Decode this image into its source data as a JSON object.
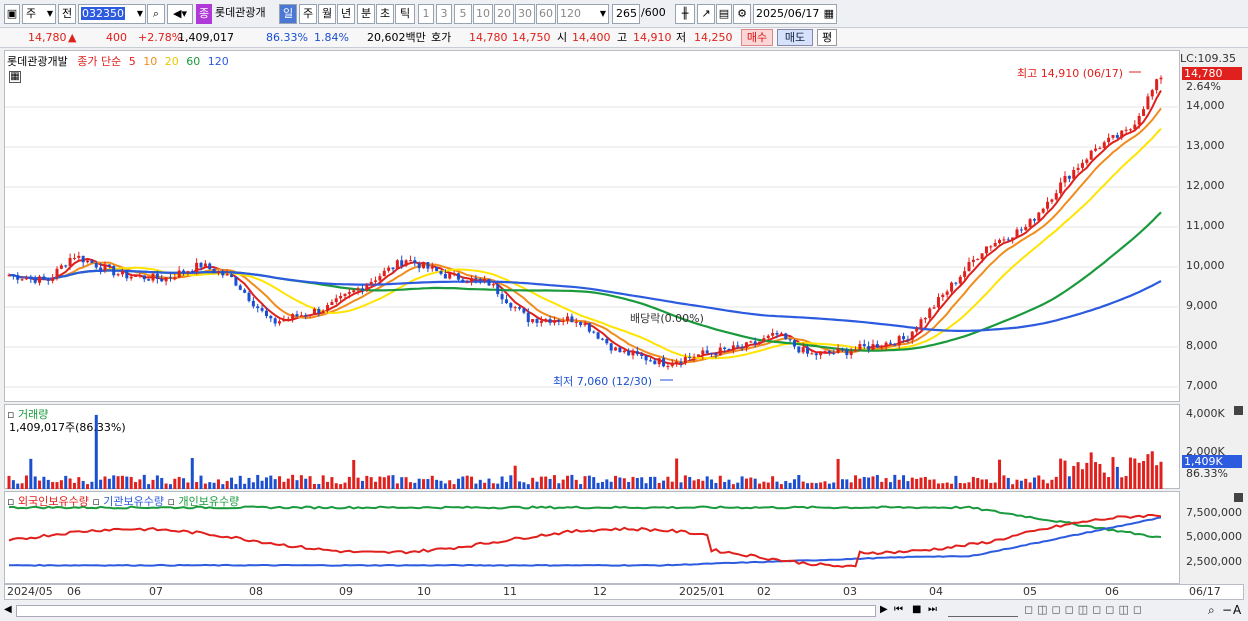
{
  "toolbar": {
    "market_select": "주",
    "period_select": "전",
    "code_value": "032350",
    "stock_badge": "종",
    "stock_name": "롯데관광개",
    "tf_day": "일",
    "tf_week": "주",
    "tf_month": "월",
    "tf_year": "년",
    "tf_min": "분",
    "tf_sec": "초",
    "tf_tick": "틱",
    "periods": [
      "1",
      "3",
      "5",
      "10",
      "20",
      "30",
      "60",
      "120"
    ],
    "count_value": "265",
    "count_total": "/600",
    "date_value": "2025/06/17"
  },
  "quote": {
    "price": "14,780",
    "up_arrow": "▲",
    "change": "400",
    "change_pct": "+2.78%",
    "volume": "1,409,017",
    "vol_ratio": "86.33%",
    "turnover": "1.84%",
    "amount": "20,602백만",
    "ask_label": "호가",
    "ask1": "14,780",
    "ask2": "14,750",
    "open_label": "시",
    "open": "14,400",
    "high_label": "고",
    "high": "14,910",
    "low_label": "저",
    "low": "14,250",
    "buy_button": "매수",
    "sell_button": "매도",
    "eval_button": "평"
  },
  "price_panel": {
    "title_name": "롯데관광개발",
    "legend_prefix": "종가 단순",
    "ma_labels": [
      "5",
      "10",
      "20",
      "60",
      "120"
    ],
    "ma_colors": [
      "#e0201c",
      "#f08c1c",
      "#ffe400",
      "#1a9a3c",
      "#2c5be0"
    ],
    "lc_label": "LC:109.35",
    "current_price_tag": "14,780",
    "current_pct": "2.64%",
    "high_annotation": "최고 14,910 (06/17)",
    "low_annotation": "최저 7,060 (12/30)",
    "dividend_annotation": "배당락(0.00%)",
    "y_ticks": [
      "14,000",
      "13,000",
      "12,000",
      "11,000",
      "10,000",
      "9,000",
      "8,000",
      "7,000"
    ]
  },
  "volume_panel": {
    "title": "거래량",
    "value_label": "1,409,017주(86.33%)",
    "y_ticks": [
      "4,000K",
      "2,000K"
    ],
    "current_tag": "1,409K",
    "current_pct": "86.33%"
  },
  "holding_panel": {
    "legend": [
      "외국인보유수량",
      "기관보유수량",
      "개인보유수량"
    ],
    "legend_colors": [
      "#e0201c",
      "#2c5be0",
      "#1a9a3c"
    ],
    "y_ticks": [
      "7,500,000",
      "5,000,000",
      "2,500,000"
    ]
  },
  "x_axis": {
    "labels": [
      "2024/05",
      "06",
      "07",
      "08",
      "09",
      "10",
      "11",
      "12",
      "2025/01",
      "02",
      "03",
      "04",
      "05",
      "06",
      "06/17"
    ]
  },
  "colors": {
    "up": "#e0201c",
    "down": "#1b4fd0",
    "accent_blue": "#2c5be0"
  }
}
